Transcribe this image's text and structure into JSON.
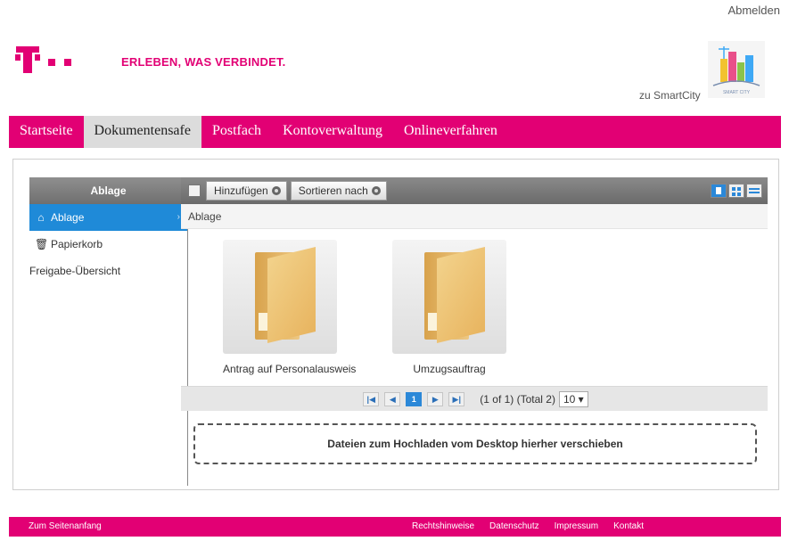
{
  "header": {
    "logout": "Abmelden",
    "slogan": "ERLEBEN, WAS VERBINDET.",
    "smartcity_link": "zu SmartCity",
    "smartcity_logo_text": "SMART CITY"
  },
  "nav": {
    "items": [
      "Startseite",
      "Dokumentensafe",
      "Postfach",
      "Kontoverwaltung",
      "Onlineverfahren"
    ],
    "active": "Dokumentensafe"
  },
  "sidebar": {
    "title": "Ablage",
    "items": [
      {
        "label": "Ablage",
        "icon": "home-icon",
        "active": true
      },
      {
        "label": "Papierkorb",
        "icon": "trash-icon",
        "active": false
      },
      {
        "label": "Freigabe-Übersicht",
        "icon": "",
        "active": false
      }
    ]
  },
  "toolbar": {
    "add_label": "Hinzufügen",
    "sort_label": "Sortieren nach",
    "views": [
      "list-view-icon",
      "grid-view-icon",
      "detail-view-icon"
    ]
  },
  "breadcrumb": "Ablage",
  "folders": [
    {
      "label": "Antrag auf Personalausweis",
      "icon": "folder-icon"
    },
    {
      "label": "Umzugsauftrag",
      "icon": "folder-icon"
    }
  ],
  "pager": {
    "first": "first-page-icon",
    "prev": "prev-page-icon",
    "current": "1",
    "next": "next-page-icon",
    "last": "last-page-icon",
    "summary": "(1 of 1) (Total 2)",
    "page_size": "10 ▾"
  },
  "dropzone": "Dateien zum Hochladen vom Desktop hierher verschieben",
  "footer": {
    "top": "Zum Seitenanfang",
    "links": [
      "Rechtshinweise",
      "Datenschutz",
      "Impressum",
      "Kontakt"
    ]
  },
  "colors": {
    "brand": "#e20074",
    "accent": "#2b88d8"
  }
}
